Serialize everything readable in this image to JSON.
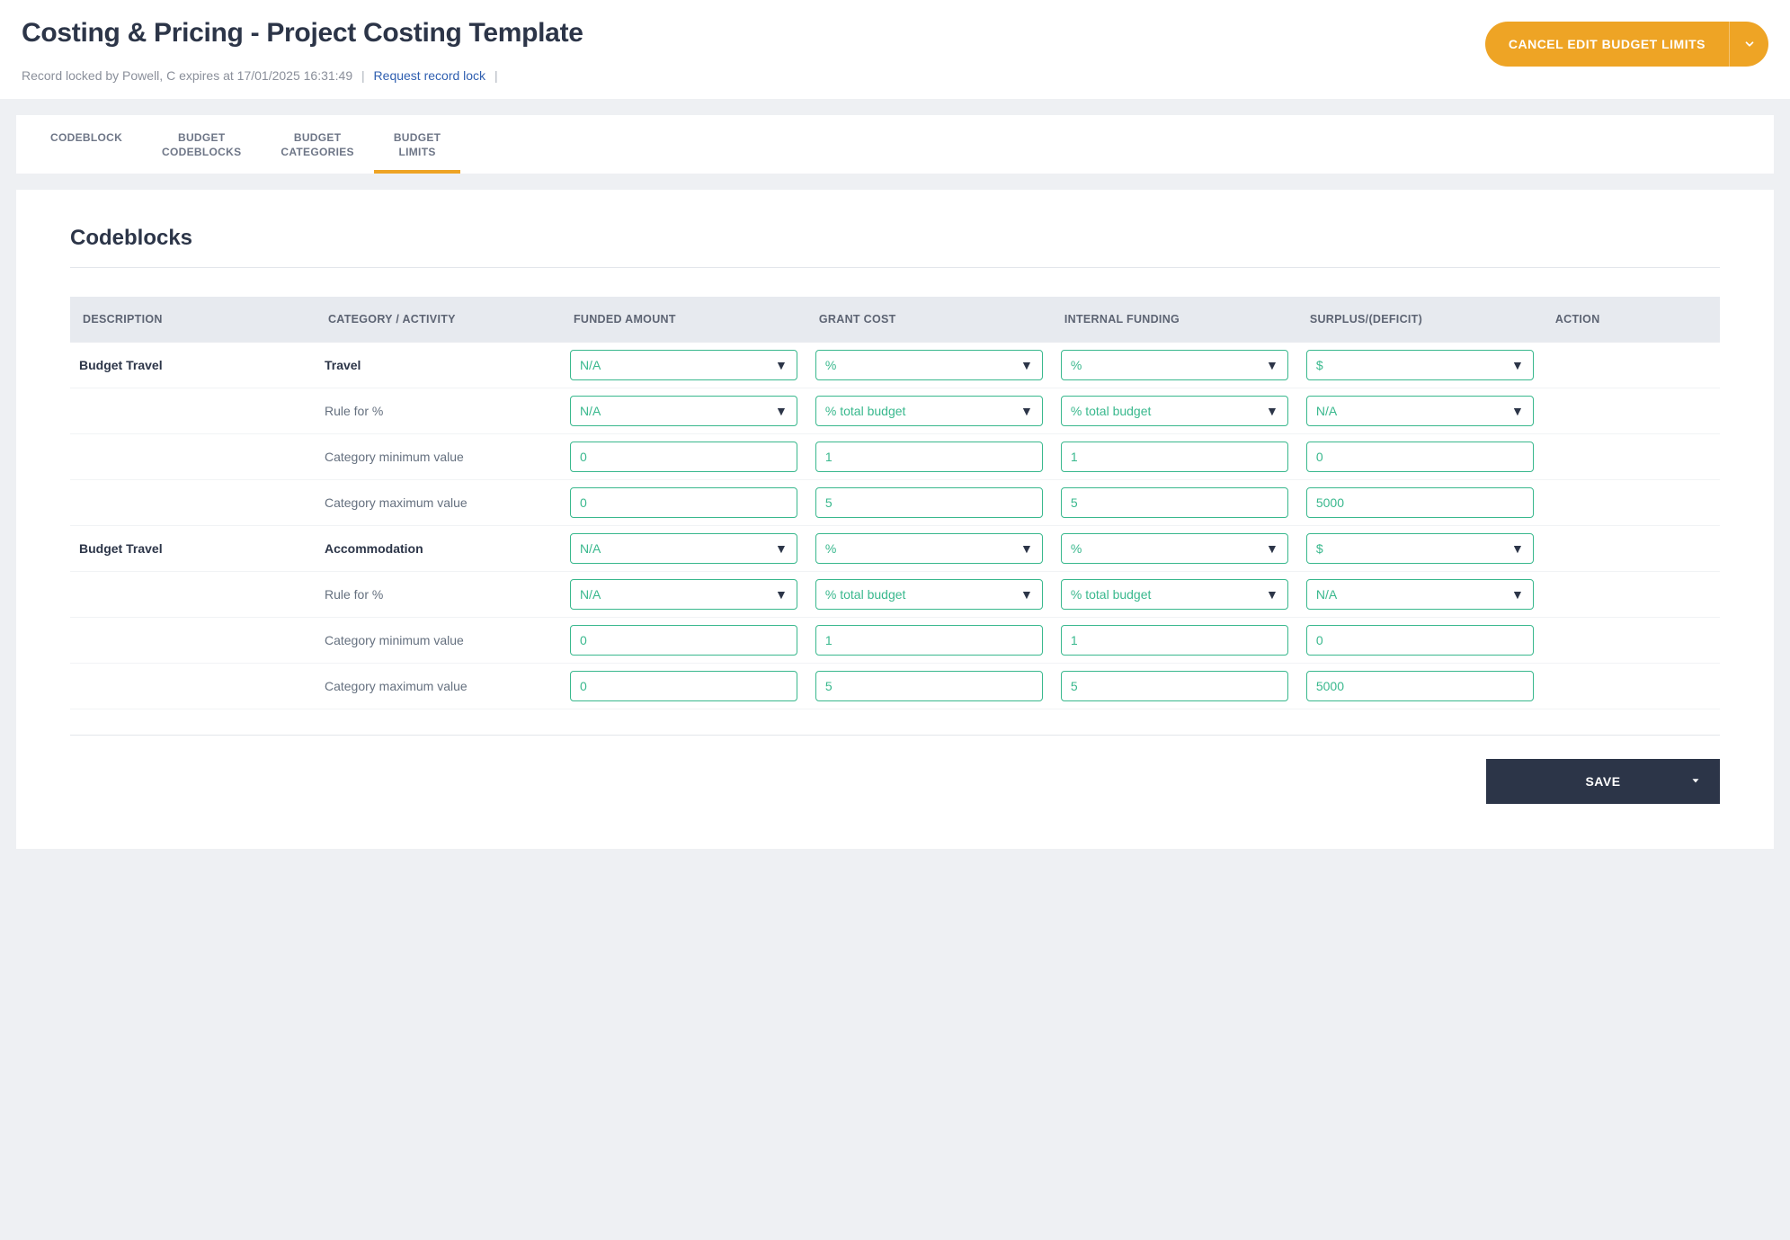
{
  "header": {
    "title": "Costing & Pricing - Project Costing Template",
    "cancel_label": "CANCEL EDIT BUDGET LIMITS",
    "lock_text": "Record locked by Powell, C expires at 17/01/2025 16:31:49",
    "lock_link": "Request record lock"
  },
  "tabs": [
    {
      "label": "CODEBLOCK",
      "active": false
    },
    {
      "label": "BUDGET\nCODEBLOCKS",
      "active": false
    },
    {
      "label": "BUDGET\nCATEGORIES",
      "active": false
    },
    {
      "label": "BUDGET\nLIMITS",
      "active": true
    }
  ],
  "section": {
    "title": "Codeblocks"
  },
  "columns": {
    "description": "DESCRIPTION",
    "category": "CATEGORY / ACTIVITY",
    "funded": "FUNDED AMOUNT",
    "grant": "GRANT COST",
    "internal": "INTERNAL FUNDING",
    "surplus": "SURPLUS/(DEFICIT)",
    "action": "ACTION"
  },
  "row_labels": {
    "rule": "Rule for %",
    "min": "Category minimum value",
    "max": "Category maximum value"
  },
  "groups": [
    {
      "description": "Budget Travel",
      "category": "Travel",
      "type": {
        "funded": "N/A",
        "grant": "%",
        "internal": "%",
        "surplus": "$"
      },
      "rule": {
        "funded": "N/A",
        "grant": "% total budget",
        "internal": "% total budget",
        "surplus": "N/A"
      },
      "min": {
        "funded": "0",
        "grant": "1",
        "internal": "1",
        "surplus": "0"
      },
      "max": {
        "funded": "0",
        "grant": "5",
        "internal": "5",
        "surplus": "5000"
      }
    },
    {
      "description": "Budget Travel",
      "category": "Accommodation",
      "type": {
        "funded": "N/A",
        "grant": "%",
        "internal": "%",
        "surplus": "$"
      },
      "rule": {
        "funded": "N/A",
        "grant": "% total budget",
        "internal": "% total budget",
        "surplus": "N/A"
      },
      "min": {
        "funded": "0",
        "grant": "1",
        "internal": "1",
        "surplus": "0"
      },
      "max": {
        "funded": "0",
        "grant": "5",
        "internal": "5",
        "surplus": "5000"
      }
    }
  ],
  "footer": {
    "save_label": "SAVE"
  }
}
